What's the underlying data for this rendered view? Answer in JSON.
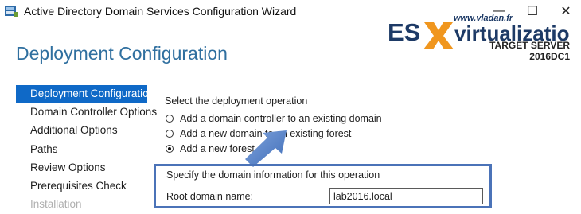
{
  "window": {
    "title": "Active Directory Domain Services Configuration Wizard",
    "minimize_glyph": "—",
    "maximize_glyph": "☐",
    "close_glyph": "✕"
  },
  "logo": {
    "text_left": "ES",
    "text_right": "virtualization",
    "url": "www.vladan.fr"
  },
  "target": {
    "label": "TARGET SERVER",
    "name": "2016DC1"
  },
  "page": {
    "title": "Deployment Configuration"
  },
  "nav": {
    "items": [
      {
        "label": "Deployment Configuration"
      },
      {
        "label": "Domain Controller Options"
      },
      {
        "label": "Additional Options"
      },
      {
        "label": "Paths"
      },
      {
        "label": "Review Options"
      },
      {
        "label": "Prerequisites Check"
      },
      {
        "label": "Installation"
      }
    ]
  },
  "deployment": {
    "label": "Select the deployment operation",
    "options": [
      {
        "label": "Add a domain controller to an existing domain",
        "selected": false
      },
      {
        "label": "Add a new domain to an existing forest",
        "selected": false
      },
      {
        "label": "Add a new forest",
        "selected": true
      }
    ]
  },
  "domain_info": {
    "label": "Specify the domain information for this operation",
    "root_label": "Root domain name:",
    "root_value": "lab2016.local"
  },
  "colors": {
    "accent": "#0f69c7",
    "title_blue": "#2f6f9f",
    "highlight_border": "#4b73b8",
    "arrow": "#5b84c4"
  }
}
